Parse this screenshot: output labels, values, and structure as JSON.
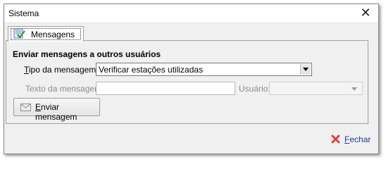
{
  "window": {
    "title": "Sistema"
  },
  "tab": {
    "label": "Mensagens",
    "icon": "checked-list-icon"
  },
  "section": {
    "title": "Enviar mensagens a outros usuários"
  },
  "form": {
    "tipo_label_mnemonic": "T",
    "tipo_label_rest": "ipo da mensagem:",
    "tipo_value": "Verificar estações utilizadas",
    "texto_label": "Texto da mensagem:",
    "texto_value": "",
    "usuario_label": "Usuário:",
    "usuario_value": ""
  },
  "buttons": {
    "enviar_mnemonic": "E",
    "enviar_rest": "nviar mensagem",
    "fechar_mnemonic": "F",
    "fechar_rest": "echar"
  },
  "colors": {
    "link": "#1a3d96",
    "close_icon": "#e0403a",
    "disabled_text": "#8c8c8c"
  }
}
